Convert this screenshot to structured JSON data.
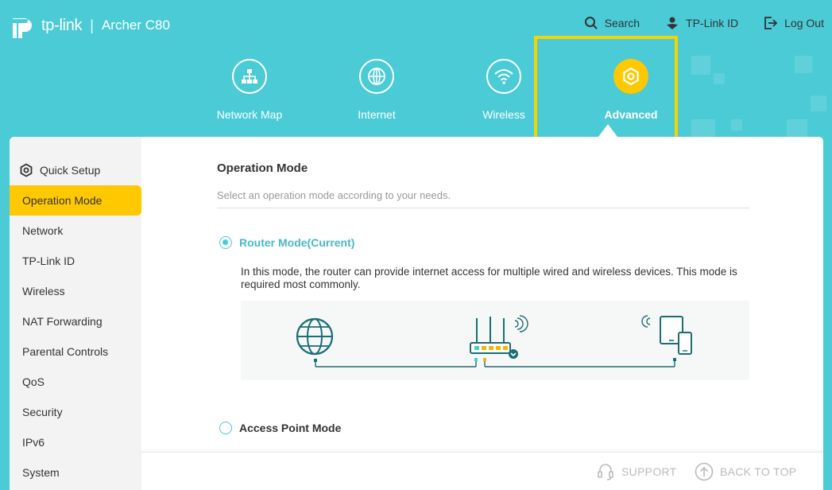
{
  "brand": {
    "name": "tp-link",
    "separator": "|",
    "model": "Archer C80"
  },
  "top_links": {
    "search": "Search",
    "tplink_id": "TP-Link ID",
    "logout": "Log Out"
  },
  "nav": {
    "items": [
      {
        "label": "Network Map",
        "icon": "network-map-icon"
      },
      {
        "label": "Internet",
        "icon": "globe-icon"
      },
      {
        "label": "Wireless",
        "icon": "wifi-icon"
      },
      {
        "label": "Advanced",
        "icon": "gear-icon",
        "active": true
      }
    ]
  },
  "sidebar": {
    "items": [
      {
        "label": "Quick Setup",
        "icon": "gear-icon"
      },
      {
        "label": "Operation Mode",
        "active": true
      },
      {
        "label": "Network"
      },
      {
        "label": "TP-Link ID"
      },
      {
        "label": "Wireless"
      },
      {
        "label": "NAT Forwarding"
      },
      {
        "label": "Parental Controls"
      },
      {
        "label": "QoS"
      },
      {
        "label": "Security"
      },
      {
        "label": "IPv6"
      },
      {
        "label": "System"
      }
    ]
  },
  "main": {
    "title": "Operation Mode",
    "subtitle": "Select an operation mode according to your needs.",
    "modes": [
      {
        "label": "Router Mode(Current)",
        "checked": true,
        "description": "In this mode, the router can provide internet access for multiple wired and wireless devices. This mode is required most commonly."
      },
      {
        "label": "Access Point Mode",
        "checked": false
      }
    ]
  },
  "footer": {
    "support": "SUPPORT",
    "back_to_top": "BACK TO TOP"
  },
  "colors": {
    "header": "#4acbd6",
    "accent": "#ffc800",
    "highlight": "#f7d300",
    "diagram_line": "#1b6e73"
  }
}
